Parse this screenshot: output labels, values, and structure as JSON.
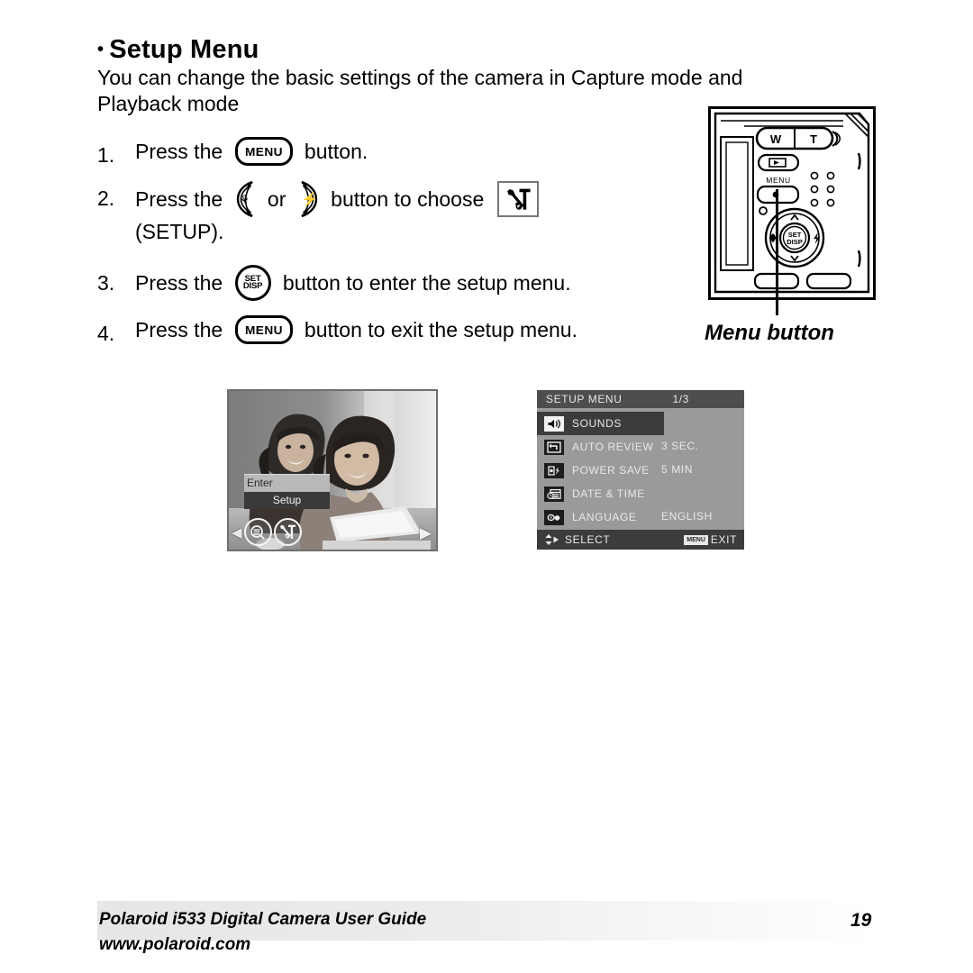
{
  "document": {
    "heading": "Setup Menu",
    "heading_bullet": "•",
    "intro_line1": "You can change the basic settings of the camera in Capture mode and",
    "intro_line2": "Playback mode"
  },
  "steps": [
    {
      "number": "1.",
      "text_before": "Press the ",
      "button_label": "MENU",
      "text_after": " button."
    },
    {
      "number": "2.",
      "text_before": "Press the ",
      "text_middle": " or ",
      "text_after": " button to choose ",
      "text_line2": "(SETUP).",
      "left_button_icon": "macro-flower-icon",
      "right_button_icon": "flash-icon",
      "choose_icon": "setup-wrench-hammer-icon"
    },
    {
      "number": "3.",
      "text_before": "Press the ",
      "button_label_top": "SET",
      "button_label_bottom": "DISP",
      "text_after": " button to enter the setup menu."
    },
    {
      "number": "4.",
      "text_before": "Press the ",
      "button_label": "MENU",
      "text_after": " button to exit the setup menu."
    }
  ],
  "camera": {
    "zoom_wide_label": "W",
    "zoom_tele_label": "T",
    "menu_label": "MENU",
    "set_label": "SET",
    "disp_label": "DISP",
    "caption": "Menu button",
    "playback_icon": "playback-icon",
    "up_icon": "up-arrow-icon",
    "down_icon": "down-arrow-icon",
    "left_icon": "macro-flower-icon",
    "right_icon": "flash-icon"
  },
  "lcd_preview": {
    "popup_row1": "Enter",
    "popup_row2": "Setup",
    "left_arrow_icon": "left-triangle-icon",
    "menu_circle_icon": "menu-list-circle-icon",
    "setup_circle_icon": "setup-wrench-hammer-circle-icon",
    "right_arrow_icon": "right-triangle-icon"
  },
  "setup_menu": {
    "title": "SETUP MENU",
    "page_indicator": "1/3",
    "rows": [
      {
        "label": "SOUNDS",
        "value": "",
        "icon": "speaker-icon",
        "selected": true
      },
      {
        "label": "AUTO REVIEW",
        "value": "3 SEC.",
        "icon": "return-arrow-icon",
        "selected": false
      },
      {
        "label": "POWER SAVE",
        "value": "5 MIN",
        "icon": "power-save-icon",
        "selected": false
      },
      {
        "label": "DATE & TIME",
        "value": "",
        "icon": "calendar-clock-icon",
        "selected": false
      },
      {
        "label": "LANGUAGE",
        "value": "ENGLISH",
        "icon": "language-icon",
        "selected": false
      }
    ],
    "footer_select": "SELECT",
    "footer_exit": "EXIT",
    "footer_menu_badge": "MENU",
    "footer_arrows_icon": "updown-right-arrows-icon"
  },
  "footer": {
    "line1": "Polaroid i533 Digital Camera User Guide",
    "line2": "www.polaroid.com",
    "page_number": "19"
  }
}
